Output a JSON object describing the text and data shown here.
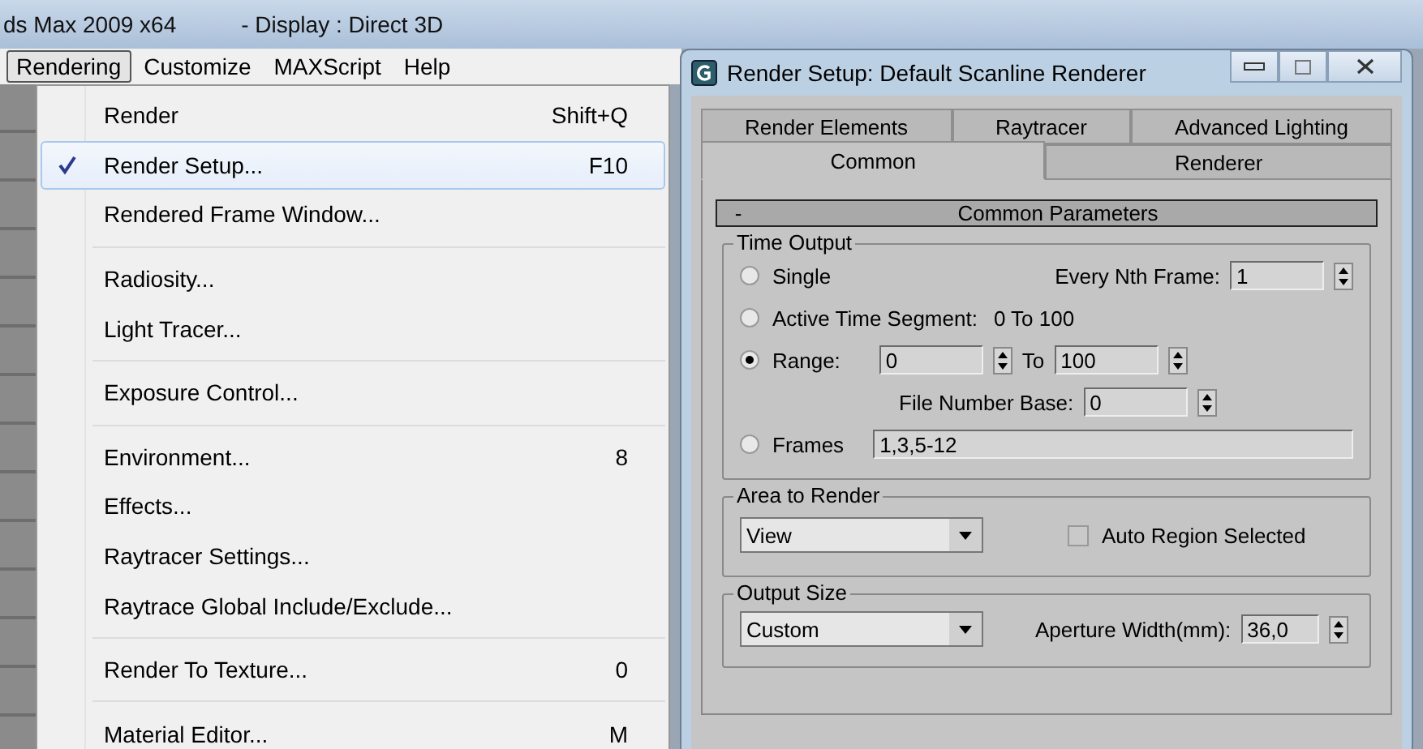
{
  "app_title": {
    "name": "ds Max  2009 x64",
    "display": "- Display : Direct 3D"
  },
  "menu_bar": [
    {
      "label": "Rendering",
      "selected": true
    },
    {
      "label": "Customize",
      "selected": false
    },
    {
      "label": "MAXScript",
      "selected": false
    },
    {
      "label": "Help",
      "selected": false
    }
  ],
  "menu": [
    {
      "kind": "item",
      "label": "Render",
      "shortcut": "Shift+Q",
      "checked": false,
      "selected": false
    },
    {
      "kind": "item",
      "label": "Render Setup...",
      "shortcut": "F10",
      "checked": true,
      "selected": true
    },
    {
      "kind": "item",
      "label": "Rendered Frame Window...",
      "checked": false,
      "selected": false
    },
    {
      "kind": "separator"
    },
    {
      "kind": "item",
      "label": "Radiosity...",
      "checked": false,
      "selected": false
    },
    {
      "kind": "item",
      "label": "Light Tracer...",
      "checked": false,
      "selected": false
    },
    {
      "kind": "separator"
    },
    {
      "kind": "item",
      "label": "Exposure Control...",
      "checked": false,
      "selected": false
    },
    {
      "kind": "separator"
    },
    {
      "kind": "item",
      "label": "Environment...",
      "shortcut": "8",
      "checked": false,
      "selected": false
    },
    {
      "kind": "item",
      "label": "Effects...",
      "checked": false,
      "selected": false
    },
    {
      "kind": "item",
      "label": "Raytracer Settings...",
      "checked": false,
      "selected": false
    },
    {
      "kind": "item",
      "label": "Raytrace Global Include/Exclude...",
      "checked": false,
      "selected": false
    },
    {
      "kind": "separator"
    },
    {
      "kind": "item",
      "label": "Render To Texture...",
      "shortcut": "0",
      "checked": false,
      "selected": false
    },
    {
      "kind": "separator"
    },
    {
      "kind": "item",
      "label": "Material Editor...",
      "shortcut": "M",
      "checked": false,
      "selected": false
    }
  ],
  "dialog": {
    "title": "Render Setup: Default Scanline Renderer",
    "tab_rows": [
      [
        {
          "label": "Render Elements",
          "selected": false
        },
        {
          "label": "Raytracer",
          "selected": false
        },
        {
          "label": "Advanced Lighting",
          "selected": false
        }
      ],
      [
        {
          "label": "Common",
          "selected": true
        },
        {
          "label": "Renderer",
          "selected": false
        }
      ]
    ],
    "rollout": {
      "toggle": "-",
      "title": "Common Parameters",
      "expanded": true
    },
    "time_output": {
      "title": "Time Output",
      "every_nth_label": "Every Nth Frame:",
      "every_nth_value": "1",
      "options": [
        {
          "label": "Single",
          "selected": false
        },
        {
          "label": "Active Time Segment:",
          "info": "0 To 100",
          "selected": false
        },
        {
          "label": "Range:",
          "selected": true
        },
        {
          "label": "Frames",
          "selected": false
        }
      ],
      "range_from": "0",
      "range_to_label": "To",
      "range_to": "100",
      "file_number_base_label": "File Number Base:",
      "file_number_base": "0",
      "frames_value": "1,3,5-12"
    },
    "area_to_render": {
      "title": "Area to Render",
      "dropdown": "View",
      "checkbox_label": "Auto Region Selected",
      "checked": false
    },
    "output_size": {
      "title": "Output Size",
      "dropdown": "Custom",
      "aperture_label": "Aperture Width(mm):",
      "aperture_value": "36,0"
    }
  }
}
